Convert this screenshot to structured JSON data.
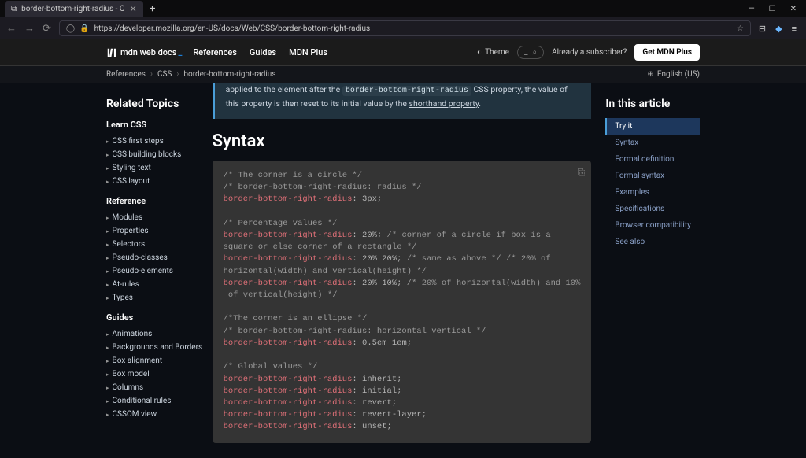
{
  "browser": {
    "tab_title": "border-bottom-right-radius - C",
    "url_display": "https://developer.mozilla.org/en-US/docs/Web/CSS/border-bottom-right-radius",
    "window": {
      "min": "—",
      "max": "☐",
      "close": "✕"
    }
  },
  "header": {
    "logo_text": "mdn web docs",
    "nav": [
      "References",
      "Guides",
      "MDN Plus"
    ],
    "theme_label": "Theme",
    "subscriber_text": "Already a subscriber?",
    "plus_button": "Get MDN Plus"
  },
  "breadcrumb": {
    "items": [
      "References",
      "CSS",
      "border-bottom-right-radius"
    ],
    "locale": "English (US)"
  },
  "sidebar_left": {
    "title": "Related Topics",
    "groups": [
      {
        "title": "Learn CSS",
        "items": [
          "CSS first steps",
          "CSS building blocks",
          "Styling text",
          "CSS layout"
        ]
      },
      {
        "title": "Reference",
        "items": [
          "Modules",
          "Properties",
          "Selectors",
          "Pseudo-classes",
          "Pseudo-elements",
          "At-rules",
          "Types"
        ]
      },
      {
        "title": "Guides",
        "items": [
          "Animations",
          "Backgrounds and Borders",
          "Box alignment",
          "Box model",
          "Columns",
          "Conditional rules",
          "CSSOM view"
        ]
      }
    ]
  },
  "note": {
    "text_before": "applied to the element after the ",
    "code": "border-bottom-right-radius",
    "text_mid": " CSS property, the value of this property is then reset to its initial value by the ",
    "link_text": "shorthand property",
    "text_after": "."
  },
  "section_title": "Syntax",
  "code": {
    "lines": [
      {
        "t": "/* The corner is a circle */",
        "c": "comment"
      },
      {
        "t": "/* border-bottom-right-radius: radius */",
        "c": "comment"
      },
      {
        "segs": [
          {
            "t": "border-bottom-right-radius",
            "c": "prop"
          },
          {
            "t": ": ",
            "c": "punct"
          },
          {
            "t": "3px",
            "c": "val"
          },
          {
            "t": ";",
            "c": "punct"
          }
        ]
      },
      {
        "t": "",
        "c": ""
      },
      {
        "t": "/* Percentage values */",
        "c": "comment"
      },
      {
        "segs": [
          {
            "t": "border-bottom-right-radius",
            "c": "prop"
          },
          {
            "t": ": ",
            "c": "punct"
          },
          {
            "t": "20%",
            "c": "val"
          },
          {
            "t": "; ",
            "c": "punct"
          },
          {
            "t": "/* corner of a circle if box is a square or else corner of a rectangle */",
            "c": "comment"
          }
        ]
      },
      {
        "segs": [
          {
            "t": "border-bottom-right-radius",
            "c": "prop"
          },
          {
            "t": ": ",
            "c": "punct"
          },
          {
            "t": "20% 20%",
            "c": "val"
          },
          {
            "t": "; ",
            "c": "punct"
          },
          {
            "t": "/* same as above */ /* 20% of horizontal(width) and vertical(height) */",
            "c": "comment"
          }
        ]
      },
      {
        "segs": [
          {
            "t": "border-bottom-right-radius",
            "c": "prop"
          },
          {
            "t": ": ",
            "c": "punct"
          },
          {
            "t": "20% 10%",
            "c": "val"
          },
          {
            "t": "; ",
            "c": "punct"
          },
          {
            "t": "/* 20% of horizontal(width) and 10% of vertical(height) */",
            "c": "comment"
          }
        ]
      },
      {
        "t": "",
        "c": ""
      },
      {
        "t": "/*The corner is an ellipse */",
        "c": "comment"
      },
      {
        "t": "/* border-bottom-right-radius: horizontal vertical */",
        "c": "comment"
      },
      {
        "segs": [
          {
            "t": "border-bottom-right-radius",
            "c": "prop"
          },
          {
            "t": ": ",
            "c": "punct"
          },
          {
            "t": "0.5em 1em",
            "c": "val"
          },
          {
            "t": ";",
            "c": "punct"
          }
        ]
      },
      {
        "t": "",
        "c": ""
      },
      {
        "t": "/* Global values */",
        "c": "comment"
      },
      {
        "segs": [
          {
            "t": "border-bottom-right-radius",
            "c": "prop"
          },
          {
            "t": ": ",
            "c": "punct"
          },
          {
            "t": "inherit",
            "c": "val"
          },
          {
            "t": ";",
            "c": "punct"
          }
        ]
      },
      {
        "segs": [
          {
            "t": "border-bottom-right-radius",
            "c": "prop"
          },
          {
            "t": ": ",
            "c": "punct"
          },
          {
            "t": "initial",
            "c": "val"
          },
          {
            "t": ";",
            "c": "punct"
          }
        ]
      },
      {
        "segs": [
          {
            "t": "border-bottom-right-radius",
            "c": "prop"
          },
          {
            "t": ": ",
            "c": "punct"
          },
          {
            "t": "revert",
            "c": "val"
          },
          {
            "t": ";",
            "c": "punct"
          }
        ]
      },
      {
        "segs": [
          {
            "t": "border-bottom-right-radius",
            "c": "prop"
          },
          {
            "t": ": ",
            "c": "punct"
          },
          {
            "t": "revert-layer",
            "c": "val"
          },
          {
            "t": ";",
            "c": "punct"
          }
        ]
      },
      {
        "segs": [
          {
            "t": "border-bottom-right-radius",
            "c": "prop"
          },
          {
            "t": ": ",
            "c": "punct"
          },
          {
            "t": "unset",
            "c": "val"
          },
          {
            "t": ";",
            "c": "punct"
          }
        ]
      }
    ]
  },
  "sidebar_right": {
    "title": "In this article",
    "items": [
      {
        "label": "Try it",
        "active": true
      },
      {
        "label": "Syntax"
      },
      {
        "label": "Formal definition"
      },
      {
        "label": "Formal syntax"
      },
      {
        "label": "Examples"
      },
      {
        "label": "Specifications"
      },
      {
        "label": "Browser compatibility"
      },
      {
        "label": "See also"
      }
    ]
  }
}
